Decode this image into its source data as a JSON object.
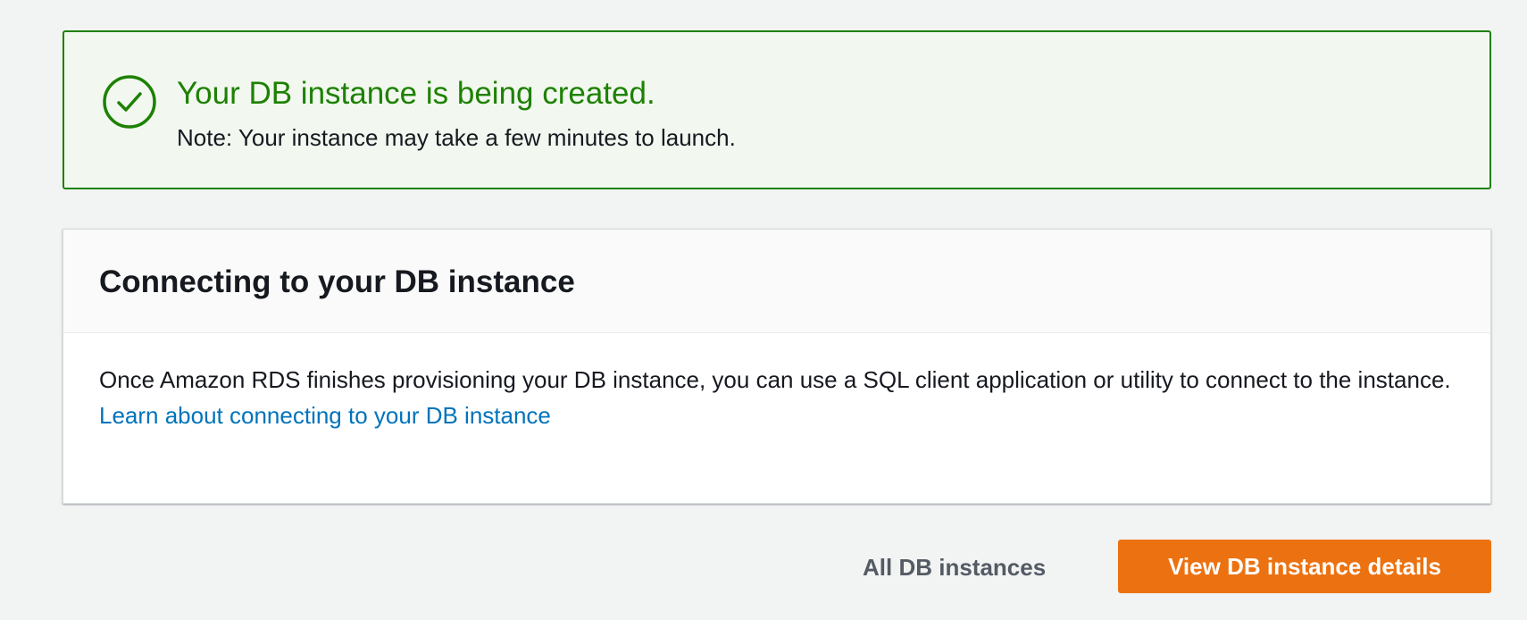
{
  "alert": {
    "status": "success",
    "icon": "check-circle-icon",
    "title": "Your DB instance is being created.",
    "note": "Note: Your instance may take a few minutes to launch."
  },
  "card": {
    "title": "Connecting to your DB instance",
    "description": "Once Amazon RDS finishes provisioning your DB instance, you can use a SQL client application or utility to connect to the instance.",
    "link_label": "Learn about connecting to your DB instance"
  },
  "actions": {
    "secondary_label": "All DB instances",
    "primary_label": "View DB instance details"
  },
  "colors": {
    "success": "#1d8102",
    "success_bg": "#f2f8f0",
    "link": "#0073bb",
    "primary_button": "#ec7211",
    "page_bg": "#f2f3f3"
  }
}
